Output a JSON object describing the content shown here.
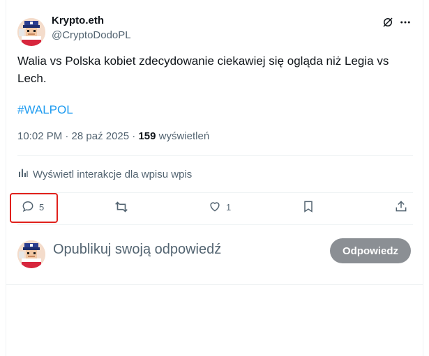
{
  "author": {
    "name": "Krypto.eth",
    "handle": "@CryptoDodoPL"
  },
  "tweet": {
    "text": "Walia vs Polska kobiet zdecydowanie ciekawiej się ogląda niż Legia vs Lech.",
    "hashtag": "#WALPOL",
    "time": "10:02 PM · 28 paź 2025 · ",
    "views_count": "159",
    "views_label": " wyświetleń"
  },
  "analytics": {
    "label": "Wyświetl interakcje dla wpisu wpis"
  },
  "actions": {
    "reply_count": "5",
    "like_count": "1"
  },
  "reply": {
    "placeholder": "Opublikuj swoją odpowiedź",
    "button_label": "Odpowiedz"
  },
  "icons": [
    "grok-icon",
    "more-icon",
    "reply-icon",
    "retweet-icon",
    "like-icon",
    "bookmark-icon",
    "share-icon",
    "analytics-icon"
  ],
  "colors": {
    "hashtag": "#1d9bf0",
    "secondary_text": "#536471",
    "reply_button_bg": "#8b8f94",
    "highlight": "#e0201b"
  }
}
